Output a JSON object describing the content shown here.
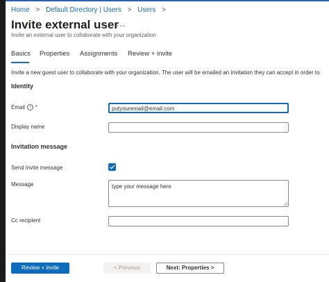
{
  "breadcrumb": {
    "items": [
      "Home",
      "Default Directory | Users",
      "Users"
    ],
    "separator": ">"
  },
  "page": {
    "title": "Invite external user",
    "more_label": "...",
    "subtitle": "Invite an external user to collaborate with your organization"
  },
  "tabs": [
    {
      "label": "Basics",
      "active": true
    },
    {
      "label": "Properties",
      "active": false
    },
    {
      "label": "Assignments",
      "active": false
    },
    {
      "label": "Review + invite",
      "active": false
    }
  ],
  "form": {
    "intro": "Invite a new guest user to collaborate with your organization. The user will be emailed an invitation they can accept in order to",
    "identity_heading": "Identity",
    "email_label": "Email",
    "email_required": "*",
    "email_info_icon": "i",
    "email_value": "putyouremail@email.com",
    "display_name_label": "Display name",
    "display_name_value": "",
    "invitation_heading": "Invitation message",
    "send_invite_label": "Send invite message",
    "send_invite_checked": true,
    "message_label": "Message",
    "message_value": "type your message here",
    "cc_label": "Cc recipient",
    "cc_value": ""
  },
  "footer": {
    "review_label": "Review + invite",
    "previous_label": "< Previous",
    "next_label": "Next: Properties  >"
  },
  "colors": {
    "accent": "#0f6cbd",
    "required": "#a4262c"
  }
}
